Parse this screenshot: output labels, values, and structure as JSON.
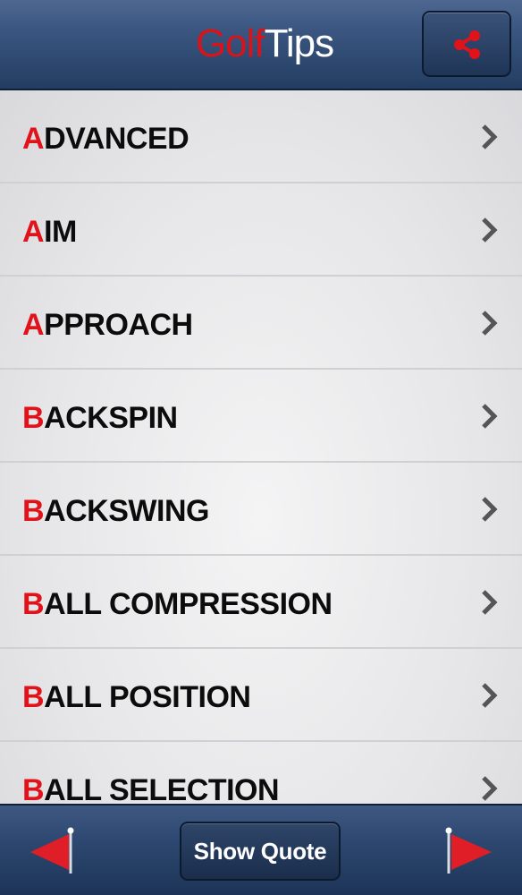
{
  "header": {
    "title_part1": "Golf",
    "title_part2": "Tips",
    "share_icon": "share-icon"
  },
  "list": {
    "items": [
      {
        "first": "A",
        "rest": "DVANCED"
      },
      {
        "first": "A",
        "rest": "IM"
      },
      {
        "first": "A",
        "rest": "PPROACH"
      },
      {
        "first": "B",
        "rest": "ACKSPIN"
      },
      {
        "first": "B",
        "rest": "ACKSWING"
      },
      {
        "first": "B",
        "rest": "ALL COMPRESSION"
      },
      {
        "first": "B",
        "rest": "ALL POSITION"
      },
      {
        "first": "B",
        "rest": "ALL SELECTION"
      }
    ]
  },
  "footer": {
    "show_quote_label": "Show Quote",
    "prev_icon": "flag-left-arrow-icon",
    "next_icon": "flag-right-arrow-icon"
  },
  "colors": {
    "accent_red": "#e0121a",
    "header_blue": "#3a5680",
    "text_dark": "#0c0c0c"
  }
}
